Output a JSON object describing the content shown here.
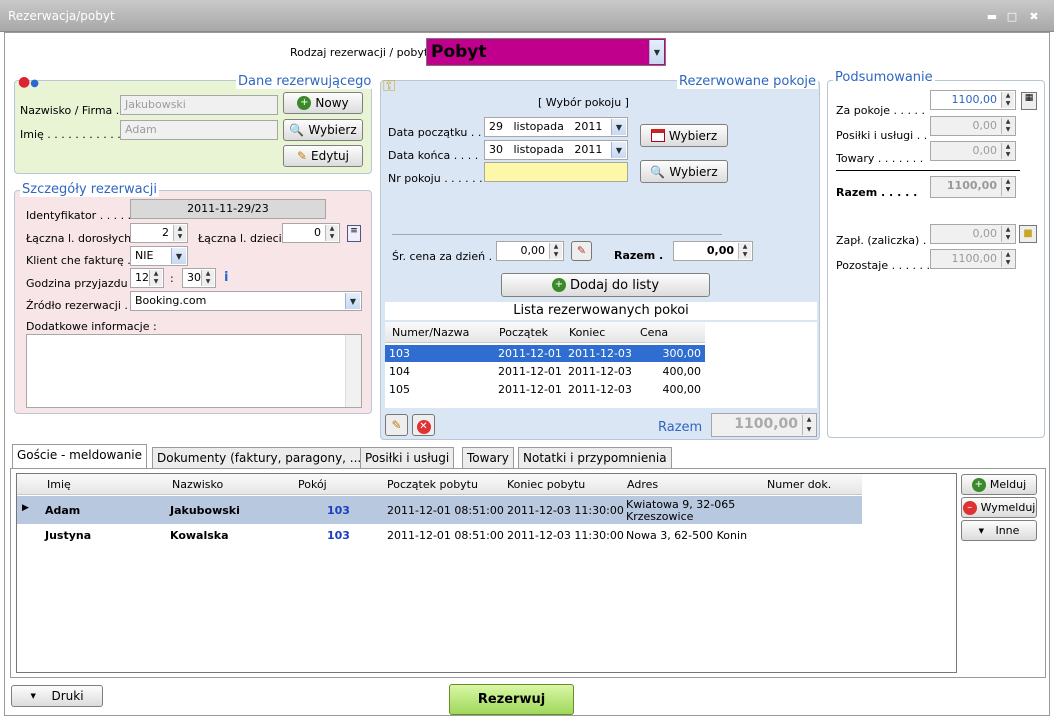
{
  "window": {
    "title": "Rezerwacja/pobyt",
    "min": "▬",
    "max": "□",
    "close": "✖"
  },
  "reservation_type": {
    "label": "Rodzaj rezerwacji / pobyt :",
    "value": "Pobyt",
    "color": "#c0008c"
  },
  "booker": {
    "title": "Dane rezerwującego",
    "surname_label": "Nazwisko / Firma .",
    "surname": "Jakubowski",
    "name_label": "Imię . . . . . . . . . . . . .",
    "name": "Adam",
    "new_btn": "Nowy",
    "choose_btn": "Wybierz",
    "edit_btn": "Edytuj"
  },
  "details": {
    "title": "Szczegóły rezerwacji",
    "id_label": "Identyfikator . . . . . .",
    "id": "2011-11-29/23",
    "adults_label": "Łączna l. dorosłych",
    "adults": "2",
    "children_label": "Łączna l. dzieci",
    "children": "0",
    "invoice_label": "Klient che fakturę .",
    "invoice": "NIE",
    "arrival_label": "Godzina przyjazdu .",
    "hour": "12",
    "colon": ":",
    "minute": "30",
    "source_label": "Źródło rezerwacji .",
    "source": "Booking.com",
    "extra_label": "Dodatkowe informacje :"
  },
  "rooms": {
    "title": "Rezerwowane pokoje",
    "choose_title": "[ Wybór pokoju ]",
    "start_label": "Data początku . . .",
    "start": {
      "day": "29",
      "month": "listopada",
      "year": "2011"
    },
    "end_label": "Data końca . . . .",
    "end": {
      "day": "30",
      "month": "listopada",
      "year": "2011"
    },
    "room_label": "Nr pokoju . . . . . . .",
    "choose_btn": "Wybierz",
    "choose_btn2": "Wybierz",
    "avg_label": "Śr. cena za dzień . .",
    "avg": "0,00",
    "total_label": "Razem .",
    "total": "0,00",
    "add_btn": "Dodaj do listy",
    "list_title": "Lista rezerwowanych pokoi",
    "columns": [
      "Numer/Nazwa",
      "Początek",
      "Koniec",
      "Cena"
    ],
    "rows": [
      [
        "103",
        "2011-12-01",
        "2011-12-03",
        "300,00"
      ],
      [
        "104",
        "2011-12-01",
        "2011-12-03",
        "400,00"
      ],
      [
        "105",
        "2011-12-01",
        "2011-12-03",
        "400,00"
      ]
    ],
    "sum_label": "Razem",
    "sum": "1100,00"
  },
  "summary": {
    "title": "Podsumowanie",
    "rooms_label": "Za pokoje . . . . .",
    "rooms": "1100,00",
    "meals_label": "Posiłki i usługi . .",
    "meals": "0,00",
    "goods_label": "Towary . . . . . . .",
    "goods": "0,00",
    "total_label": "Razem . . . . .",
    "total": "1100,00",
    "paid_label": "Zapł. (zaliczka) . .",
    "paid": "0,00",
    "remaining_label": "Pozostaje . . . . . .",
    "remaining": "1100,00"
  },
  "tabs": [
    "Goście - meldowanie",
    "Dokumenty (faktury, paragony, ...)",
    "Posiłki i usługi",
    "Towary",
    "Notatki i przypomnienia"
  ],
  "guests": {
    "columns": [
      "Imię",
      "Nazwisko",
      "Pokój",
      "Początek pobytu",
      "Koniec pobytu",
      "Adres",
      "Numer dok."
    ],
    "rows": [
      {
        "first": "Adam",
        "last": "Jakubowski",
        "room": "103",
        "start": "2011-12-01 08:51:00",
        "end": "2011-12-03 11:30:00",
        "addr1": "Kwiatowa 9, 32-065",
        "addr2": "Krzeszowice",
        "doc": ""
      },
      {
        "first": "Justyna",
        "last": "Kowalska",
        "room": "103",
        "start": "2011-12-01 08:51:00",
        "end": "2011-12-03 11:30:00",
        "addr1": "Nowa 3, 62-500 Konin",
        "addr2": "",
        "doc": ""
      }
    ],
    "checkin_btn": "Melduj",
    "checkout_btn": "Wymelduj",
    "other_btn": "Inne"
  },
  "footer": {
    "print_btn": "Druki",
    "reserve_btn": "Rezerwuj"
  }
}
